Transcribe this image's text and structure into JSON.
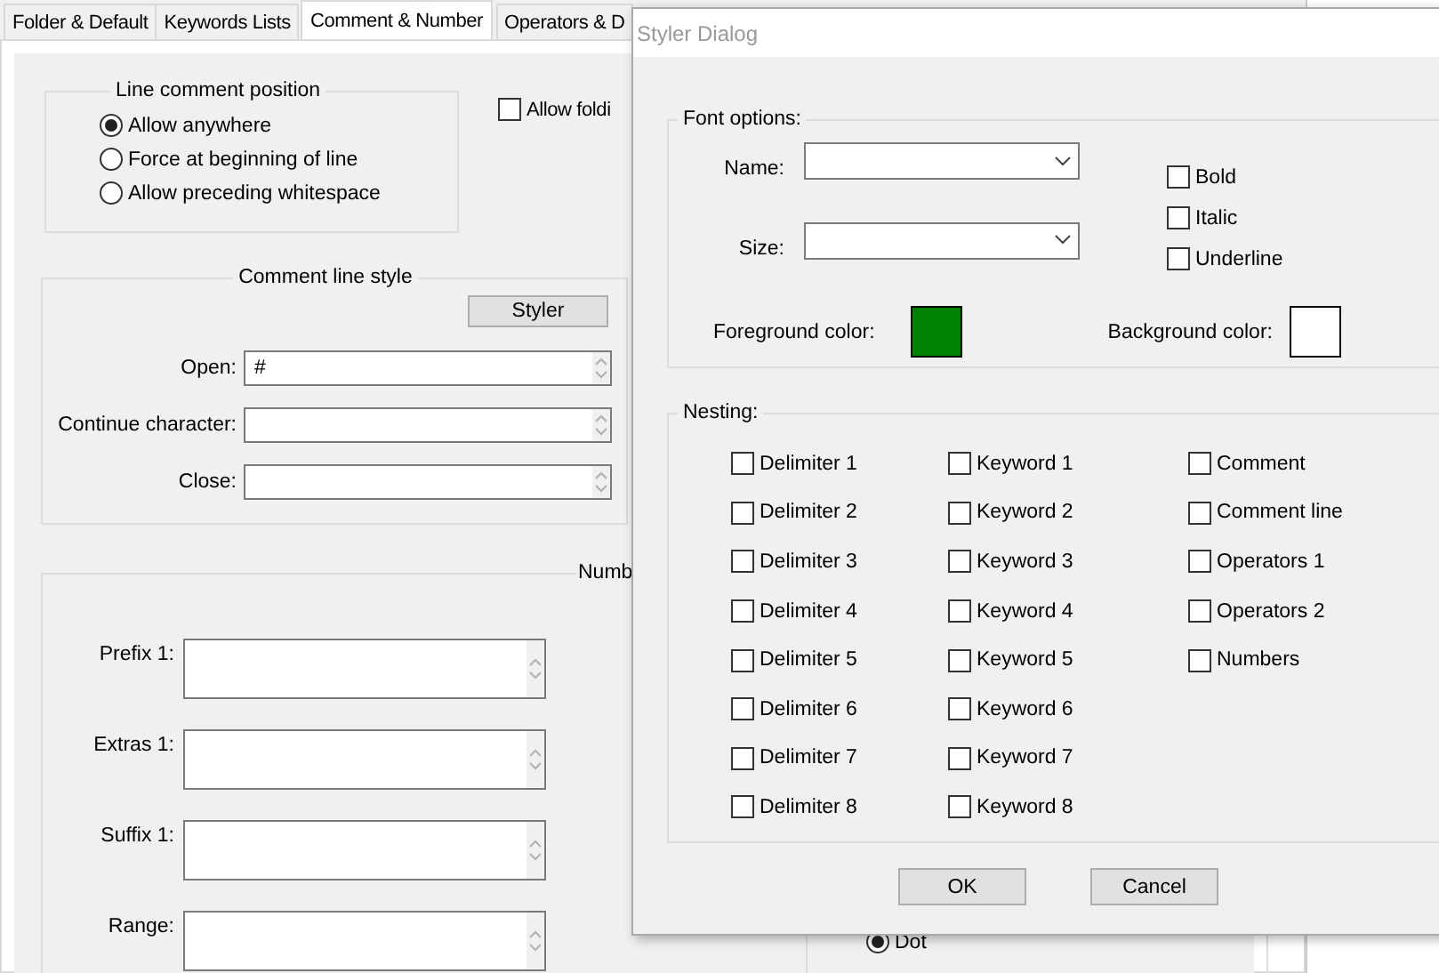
{
  "background_window": {
    "tabs": [
      {
        "label": "Folder & Default",
        "selected": false
      },
      {
        "label": "Keywords Lists",
        "selected": false
      },
      {
        "label": "Comment & Number",
        "selected": true
      },
      {
        "label": "Operators & D",
        "selected": false
      }
    ],
    "line_comment_position": {
      "title": "Line comment position",
      "options": [
        {
          "label": "Allow anywhere",
          "selected": true
        },
        {
          "label": "Force at beginning of line",
          "selected": false
        },
        {
          "label": "Allow preceding whitespace",
          "selected": false
        }
      ]
    },
    "allow_folding": {
      "label": "Allow foldi",
      "checked": false
    },
    "comment_line_style": {
      "title": "Comment line style",
      "styler_button": "Styler",
      "fields": [
        {
          "label": "Open:",
          "value": "#"
        },
        {
          "label": "Continue character:"
        },
        {
          "label": "Close:"
        }
      ]
    },
    "number_group": {
      "title": "Numb",
      "fields": [
        {
          "label": "Prefix 1:"
        },
        {
          "label": "Extras 1:"
        },
        {
          "label": "Suffix 1:"
        },
        {
          "label": "Range:"
        }
      ]
    },
    "decimal_separator": {
      "options": [
        {
          "label": "Dot",
          "selected": true
        }
      ]
    }
  },
  "styler_dialog": {
    "title": "Styler Dialog",
    "font_options": {
      "title": "Font options:",
      "name": {
        "label": "Name:"
      },
      "size": {
        "label": "Size:"
      },
      "styles": [
        {
          "label": "Bold",
          "checked": false
        },
        {
          "label": "Italic",
          "checked": false
        },
        {
          "label": "Underline",
          "checked": false
        }
      ],
      "foreground": {
        "label": "Foreground color:",
        "color": "#008000"
      },
      "background": {
        "label": "Background color:",
        "color": "#ffffff"
      }
    },
    "nesting": {
      "title": "Nesting:",
      "columns": [
        [
          {
            "label": "Delimiter 1",
            "checked": false
          },
          {
            "label": "Delimiter 2",
            "checked": false
          },
          {
            "label": "Delimiter 3",
            "checked": false
          },
          {
            "label": "Delimiter 4",
            "checked": false
          },
          {
            "label": "Delimiter 5",
            "checked": false
          },
          {
            "label": "Delimiter 6",
            "checked": false
          },
          {
            "label": "Delimiter 7",
            "checked": false
          },
          {
            "label": "Delimiter 8",
            "checked": false
          }
        ],
        [
          {
            "label": "Keyword 1",
            "checked": false
          },
          {
            "label": "Keyword 2",
            "checked": false
          },
          {
            "label": "Keyword 3",
            "checked": false
          },
          {
            "label": "Keyword 4",
            "checked": false
          },
          {
            "label": "Keyword 5",
            "checked": false
          },
          {
            "label": "Keyword 6",
            "checked": false
          },
          {
            "label": "Keyword 7",
            "checked": false
          },
          {
            "label": "Keyword 8",
            "checked": false
          }
        ],
        [
          {
            "label": "Comment",
            "checked": false
          },
          {
            "label": "Comment line",
            "checked": false
          },
          {
            "label": "Operators 1",
            "checked": false
          },
          {
            "label": "Operators 2",
            "checked": false
          },
          {
            "label": "Numbers",
            "checked": false
          }
        ]
      ]
    },
    "buttons": [
      "OK",
      "Cancel"
    ]
  }
}
